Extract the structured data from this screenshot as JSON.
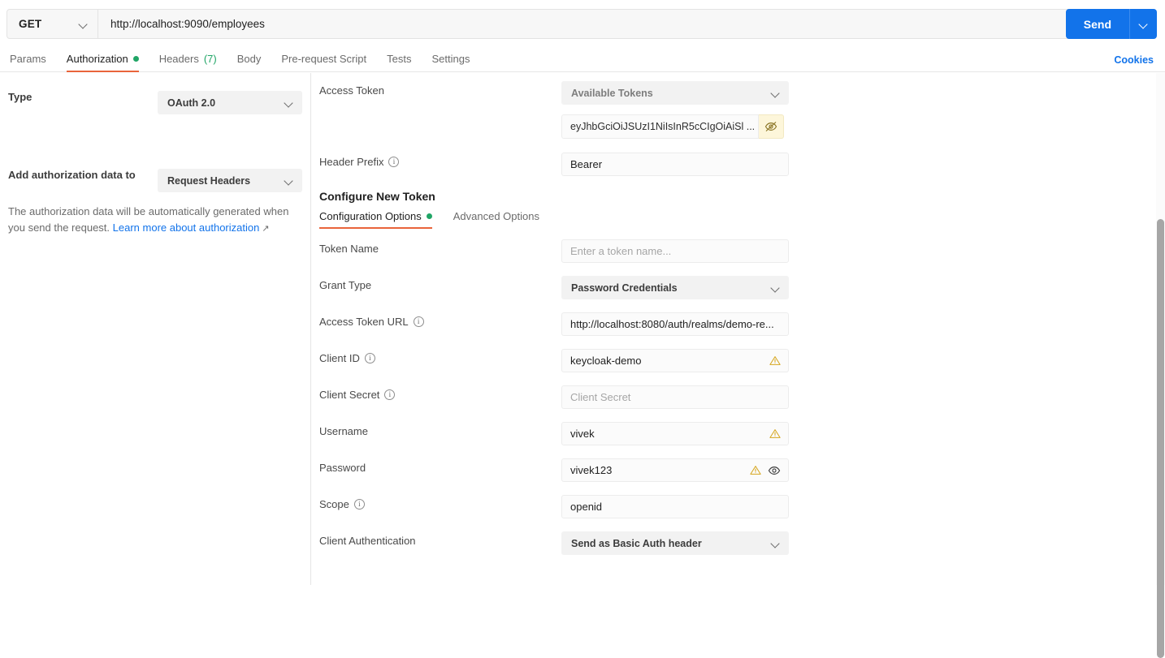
{
  "request": {
    "method": "GET",
    "method_caret_icon": "chevron-down-icon",
    "url": "http://localhost:9090/employees",
    "send_label": "Send",
    "send_caret_icon": "chevron-down-icon"
  },
  "tabs": [
    {
      "label": "Params",
      "active": false,
      "badge": null,
      "dot": false
    },
    {
      "label": "Authorization",
      "active": true,
      "badge": null,
      "dot": true
    },
    {
      "label": "Headers",
      "active": false,
      "badge": "(7)",
      "dot": false
    },
    {
      "label": "Body",
      "active": false,
      "badge": null,
      "dot": false
    },
    {
      "label": "Pre-request Script",
      "active": false,
      "badge": null,
      "dot": false
    },
    {
      "label": "Tests",
      "active": false,
      "badge": null,
      "dot": false
    },
    {
      "label": "Settings",
      "active": false,
      "badge": null,
      "dot": false
    }
  ],
  "cookies_link": "Cookies",
  "sidebar": {
    "type_label": "Type",
    "type_value": "OAuth 2.0",
    "type_caret_icon": "chevron-down-icon",
    "help_text_before": "The authorization data will be automatically generated when you send the request. ",
    "help_link": "Learn more about authorization",
    "help_link_arrow": "↗",
    "add_data_label": "Add authorization data to",
    "add_data_value": "Request Headers",
    "add_data_caret_icon": "chevron-down-icon"
  },
  "main": {
    "access_token_label": "Access Token",
    "available_tokens_value": "Available Tokens",
    "available_tokens_caret_icon": "chevron-down-icon",
    "token_value": "eyJhbGciOiJSUzI1NiIsInR5cCIgOiAiSl ...",
    "token_eye_icon": "eye-off-icon",
    "header_prefix_label": "Header Prefix",
    "header_prefix_info_icon": "info-icon",
    "header_prefix_value": "Bearer",
    "configure_title": "Configure New Token",
    "subtabs": [
      {
        "label": "Configuration Options",
        "active": true,
        "dot": true
      },
      {
        "label": "Advanced Options",
        "active": false,
        "dot": false
      }
    ],
    "fields": [
      {
        "name": "token-name",
        "label": "Token Name",
        "info": false,
        "control": "text",
        "value": "",
        "placeholder": "Enter a token name...",
        "warn": false,
        "eye": false
      },
      {
        "name": "grant-type",
        "label": "Grant Type",
        "info": false,
        "control": "select",
        "value": "Password Credentials",
        "placeholder": "",
        "warn": false,
        "eye": false
      },
      {
        "name": "access-token-url",
        "label": "Access Token URL",
        "info": true,
        "control": "text",
        "value": "http://localhost:8080/auth/realms/demo-re...",
        "placeholder": "",
        "warn": false,
        "eye": false
      },
      {
        "name": "client-id",
        "label": "Client ID",
        "info": true,
        "control": "text",
        "value": "keycloak-demo",
        "placeholder": "",
        "warn": true,
        "eye": false
      },
      {
        "name": "client-secret",
        "label": "Client Secret",
        "info": true,
        "control": "text",
        "value": "",
        "placeholder": "Client Secret",
        "warn": false,
        "eye": false
      },
      {
        "name": "username",
        "label": "Username",
        "info": false,
        "control": "text",
        "value": "vivek",
        "placeholder": "",
        "warn": true,
        "eye": false
      },
      {
        "name": "password",
        "label": "Password",
        "info": false,
        "control": "text",
        "value": "vivek123",
        "placeholder": "",
        "warn": true,
        "eye": true
      },
      {
        "name": "scope",
        "label": "Scope",
        "info": true,
        "control": "text",
        "value": "openid",
        "placeholder": "",
        "warn": false,
        "eye": false
      },
      {
        "name": "client-authentication",
        "label": "Client Authentication",
        "info": false,
        "control": "select",
        "value": "Send as Basic Auth header",
        "placeholder": "",
        "warn": false,
        "eye": false
      }
    ]
  },
  "colors": {
    "accent_orange": "#e9643b",
    "accent_blue": "#1273ea",
    "status_green": "#20a566",
    "warn_amber": "#d6a61e",
    "token_highlight": "#fdf6da"
  }
}
